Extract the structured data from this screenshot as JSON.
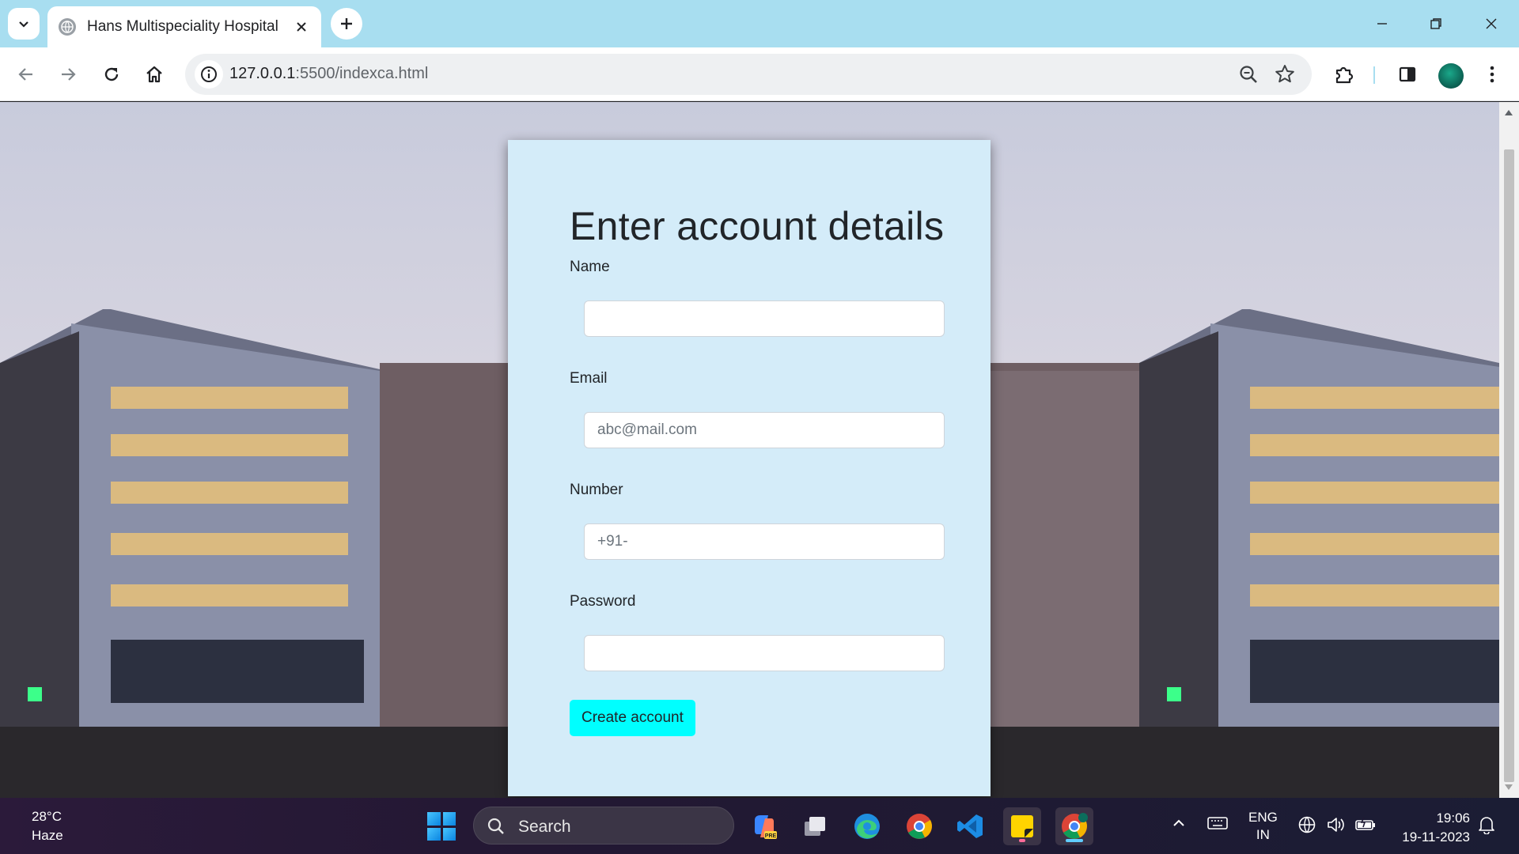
{
  "browser": {
    "tab_title": "Hans Multispeciality Hospital",
    "url_host": "127.0.0.1",
    "url_rest": ":5500/indexca.html"
  },
  "form": {
    "heading": "Enter account details",
    "name_label": "Name",
    "name_value": "",
    "email_label": "Email",
    "email_placeholder": "abc@mail.com",
    "number_label": "Number",
    "number_placeholder": "+91-",
    "password_label": "Password",
    "submit_label": "Create account"
  },
  "taskbar": {
    "temperature": "28°C",
    "weather": "Haze",
    "search_placeholder": "Search",
    "language": "ENG",
    "region": "IN",
    "time": "19:06",
    "date": "19-11-2023"
  },
  "colors": {
    "card_bg": "#d4ecf9",
    "submit_bg": "#00ffff",
    "tabstrip_bg": "#a8def0"
  }
}
